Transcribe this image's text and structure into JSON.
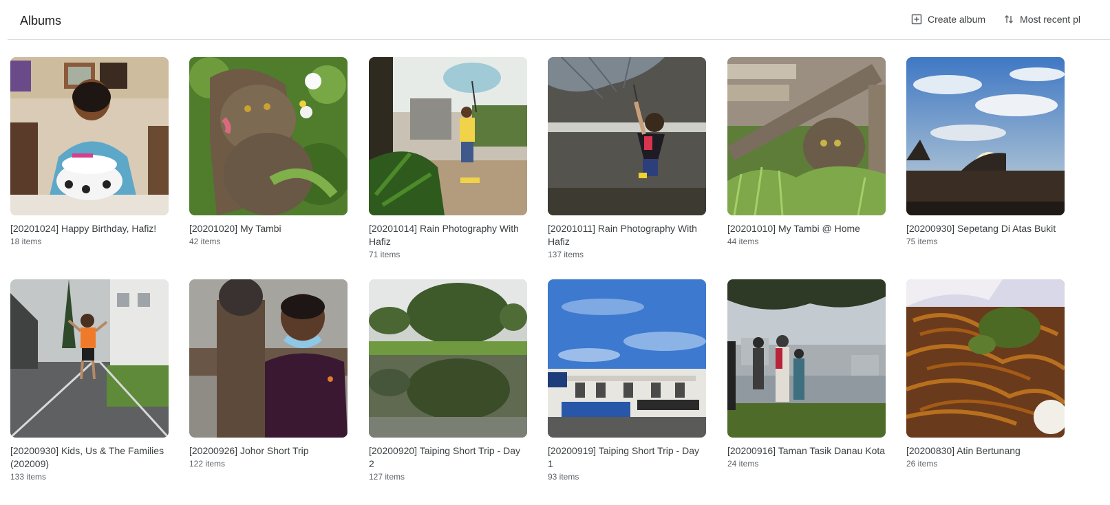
{
  "header": {
    "title": "Albums",
    "create_album_label": "Create album",
    "sort_label": "Most recent pl",
    "icons": {
      "create": "add-box-icon",
      "sort": "sort-arrows-icon"
    }
  },
  "albums": [
    {
      "title": "[20201024] Happy Birthday, Hafiz!",
      "count": "18 items"
    },
    {
      "title": "[20201020] My Tambi",
      "count": "42 items"
    },
    {
      "title": "[20201014] Rain Photography With Hafiz",
      "count": "71 items"
    },
    {
      "title": "[20201011] Rain Photography With Hafiz",
      "count": "137 items"
    },
    {
      "title": "[20201010] My Tambi @ Home",
      "count": "44 items"
    },
    {
      "title": "[20200930] Sepetang Di Atas Bukit",
      "count": "75 items"
    },
    {
      "title": "[20200930] Kids, Us & The Families (202009)",
      "count": "133 items"
    },
    {
      "title": "[20200926] Johor Short Trip",
      "count": "122 items"
    },
    {
      "title": "[20200920] Taiping Short Trip - Day 2",
      "count": "127 items"
    },
    {
      "title": "[20200919] Taiping Short Trip - Day 1",
      "count": "93 items"
    },
    {
      "title": "[20200916] Taman Tasik Danau Kota",
      "count": "24 items"
    },
    {
      "title": "[20200830] Atin Bertunang",
      "count": "26 items"
    }
  ],
  "colors": {
    "divider": "#dadce0",
    "title_text": "#3c4043",
    "count_text": "#5f6368"
  }
}
